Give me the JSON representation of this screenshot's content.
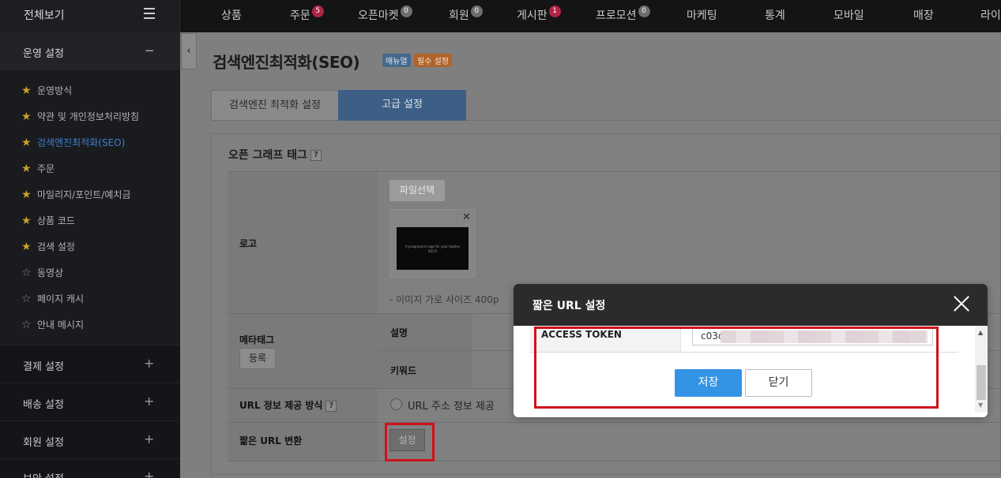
{
  "topbar": {
    "all_menu": "전체보기",
    "nav": [
      {
        "label": "상품",
        "badge": ""
      },
      {
        "label": "주문",
        "badge": "5"
      },
      {
        "label": "오픈마켓",
        "badge": "0"
      },
      {
        "label": "회원",
        "badge": "0"
      },
      {
        "label": "게시판",
        "badge": "1"
      },
      {
        "label": "프로모션",
        "badge": "0"
      },
      {
        "label": "마케팅",
        "badge": ""
      },
      {
        "label": "통계",
        "badge": ""
      },
      {
        "label": "모바일",
        "badge": ""
      },
      {
        "label": "매장",
        "badge": ""
      },
      {
        "label": "라이",
        "badge": ""
      }
    ]
  },
  "sidebar": {
    "section_title": "운영 설정",
    "items": [
      {
        "label": "운영방식",
        "star": "full"
      },
      {
        "label": "약관 및 개인정보처리방침",
        "star": "full"
      },
      {
        "label": "검색엔진최적화(SEO)",
        "star": "full"
      },
      {
        "label": "주문",
        "star": "full"
      },
      {
        "label": "마일리지/포인트/예치금",
        "star": "full"
      },
      {
        "label": "상품 코드",
        "star": "full"
      },
      {
        "label": "검색 설정",
        "star": "full"
      },
      {
        "label": "동영상",
        "star": "empty"
      },
      {
        "label": "페이지 캐시",
        "star": "empty"
      },
      {
        "label": "안내 메시지",
        "star": "empty"
      }
    ],
    "categories": [
      "결제 설정",
      "배송 설정",
      "회원 설정",
      "보안 설정"
    ]
  },
  "main": {
    "title": "검색엔진최적화(SEO)",
    "tag_manual": "매뉴얼",
    "tag_required": "필수 설정",
    "tabs": [
      "검색엔진 최적화 설정",
      "고급 설정"
    ],
    "section_title": "오픈 그래프 태그",
    "help": "?",
    "logo": {
      "label": "로고",
      "file_button": "파일선택",
      "thumb_text": "A progressive logo for your tagline RECO",
      "note": "- 이미지 가로 사이즈 400p"
    },
    "meta": {
      "label": "메타태그",
      "register_button": "등록",
      "description_label": "설명",
      "keyword_label": "키워드"
    },
    "url_info": {
      "label": "URL 정보 제공 방식",
      "radio_label": "URL 주소 정보 제공"
    },
    "short_url": {
      "label": "짧은 URL 변환",
      "button": "설정"
    }
  },
  "modal": {
    "title": "짧은 URL 설정",
    "token_label": "ACCESS TOKEN",
    "token_value": "c03c",
    "save": "저장",
    "close": "닫기"
  },
  "colors": {
    "highlight": "#d0121c",
    "primary": "#3394e6",
    "active_tab": "#3d5f85"
  }
}
